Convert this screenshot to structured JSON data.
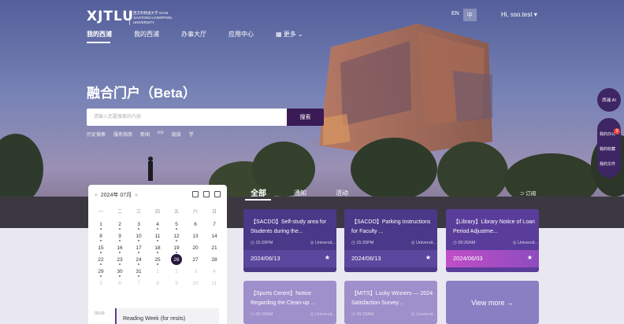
{
  "header": {
    "logo": "XJTLU",
    "logo_sub": "西交利物浦大学 XI'AN JIAOTONG-LIVERPOOL UNIVERSITY",
    "nav": [
      "我的西浦",
      "我的西浦",
      "办事大厅",
      "应用中心",
      "更多"
    ],
    "lang_en": "EN",
    "lang_zh": "中",
    "user": "Hi, sso.test ▾"
  },
  "hero": {
    "title": "融合门户（Beta）",
    "search_placeholder": "请输入您要搜索的内容",
    "search_button": "搜索",
    "history": [
      "历史搜索",
      "服务指南",
      "新闻",
      "ins",
      "链接",
      "学"
    ]
  },
  "side": {
    "ai": "西浦 AI",
    "items": [
      "我的办公",
      "我的收藏",
      "我的文件"
    ],
    "badge": "3"
  },
  "calendar": {
    "month": "2024年 07月",
    "prev": "«",
    "next": "»",
    "weekdays": [
      "一",
      "二",
      "三",
      "四",
      "五",
      "六",
      "日"
    ],
    "weeks": [
      [
        "1",
        "2",
        "3",
        "4",
        "5",
        "6",
        "7"
      ],
      [
        "8",
        "9",
        "10",
        "11",
        "12",
        "13",
        "14"
      ],
      [
        "15",
        "16",
        "17",
        "18",
        "19",
        "20",
        "21"
      ],
      [
        "22",
        "23",
        "24",
        "25",
        "26",
        "27",
        "28"
      ],
      [
        "29",
        "30",
        "31",
        "1",
        "2",
        "3",
        "4"
      ],
      [
        "5",
        "6",
        "7",
        "8",
        "9",
        "10",
        "11"
      ]
    ],
    "today": "26",
    "event_time": "00:00",
    "event_title": "Reading Week (for resits)"
  },
  "tabs": {
    "items": [
      "全部",
      "通知",
      "活动"
    ],
    "subscribe": "订阅"
  },
  "cards": [
    {
      "title": "【SACDO】Self-study area for Students during the...",
      "time": "15:20PM",
      "source": "Universit...",
      "date": "2024/06/13",
      "color": "#4f3d8e",
      "foot": "#5b479d"
    },
    {
      "title": "【SACDO】Parking Instructions for Faculty ...",
      "time": "15:20PM",
      "source": "Universit...",
      "date": "2024/06/13",
      "color": "#4f3d8e",
      "foot": "#5b479d"
    },
    {
      "title": "【Library】Library Notice of Loan Period Adjustme...",
      "time": "09:26AM",
      "source": "Universit...",
      "date": "2024/06/03",
      "color": "#5a3d9a",
      "foot": "#b04ec3"
    },
    {
      "title": "【Sports Centre】Notice Regarding the Clean-up ...",
      "time": "09:25AM",
      "source": "Universit...",
      "date": "",
      "color": "#9f8fcb",
      "foot": "#9f8fcb"
    },
    {
      "title": "【MITS】Lucky Winners — 2024 Satisfaction Survey...",
      "time": "09:23AM",
      "source": "Universit...",
      "date": "",
      "color": "#9f8fcb",
      "foot": "#9f8fcb"
    }
  ],
  "view_more": "View more →"
}
